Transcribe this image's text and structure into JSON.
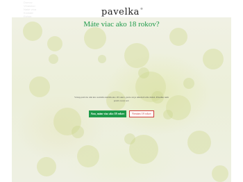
{
  "header": {
    "logo_text": "pavelka",
    "logo_mark": "®",
    "nav_links": [
      "Domov",
      "Vinárstvo",
      "Naše vína",
      "Kontakt",
      "Eshop"
    ]
  },
  "age_gate": {
    "question": "Máte viac ako 18 rokov?",
    "message": "Vstup patrí do rúk len osobám starším ako 18 rokov, preto sú je alkohol'ovik dobré. Pavelka nam protiv nový reč.",
    "yes_label": "Ano, mám viac ako 18 rokov",
    "no_label": "Nemám 18 rokov"
  },
  "colors": {
    "accent_green": "#1f9a4a",
    "decline_red": "#cf3b3b"
  }
}
